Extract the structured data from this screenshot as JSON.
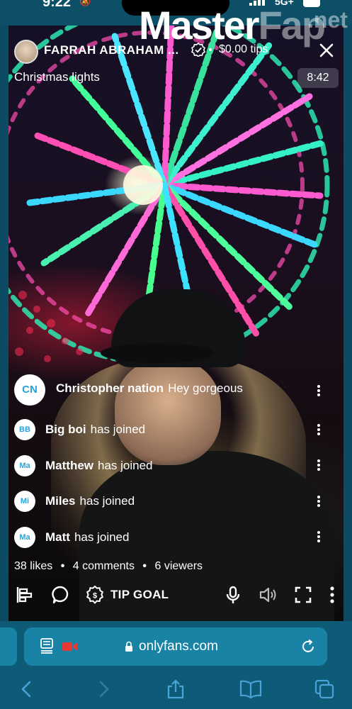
{
  "status_bar": {
    "time": "9:22",
    "network": "5G+"
  },
  "watermark": {
    "part1": "Master",
    "part2": "Fap",
    "suffix": ".net"
  },
  "stream": {
    "creator_name": "FARRAH ABRAHAM ...",
    "tips": "$0.00 tips",
    "title": "Christmas lights",
    "timer": "8:42"
  },
  "comments": [
    {
      "initials": "CN",
      "user": "Christopher nation",
      "text": "Hey gorgeous"
    },
    {
      "initials": "BB",
      "user": "Big boi",
      "text": "has joined"
    },
    {
      "initials": "Ma",
      "user": "Matthew",
      "text": "has joined"
    },
    {
      "initials": "Mi",
      "user": "Miles",
      "text": "has joined"
    },
    {
      "initials": "Ma",
      "user": "Matt",
      "text": "has joined"
    }
  ],
  "stats": {
    "likes_count": "38",
    "likes_label": "likes",
    "comments_count": "4",
    "comments_label": "comments",
    "viewers_count": "6",
    "viewers_label": "viewers"
  },
  "controls": {
    "tip_goal_label": "TIP GOAL"
  },
  "browser": {
    "url": "onlyfans.com"
  },
  "colors": {
    "avatar_text": "#2aa4d8",
    "browser_bar": "#0e5b78",
    "address_bar": "#1983a5",
    "record_red": "#e53935"
  }
}
